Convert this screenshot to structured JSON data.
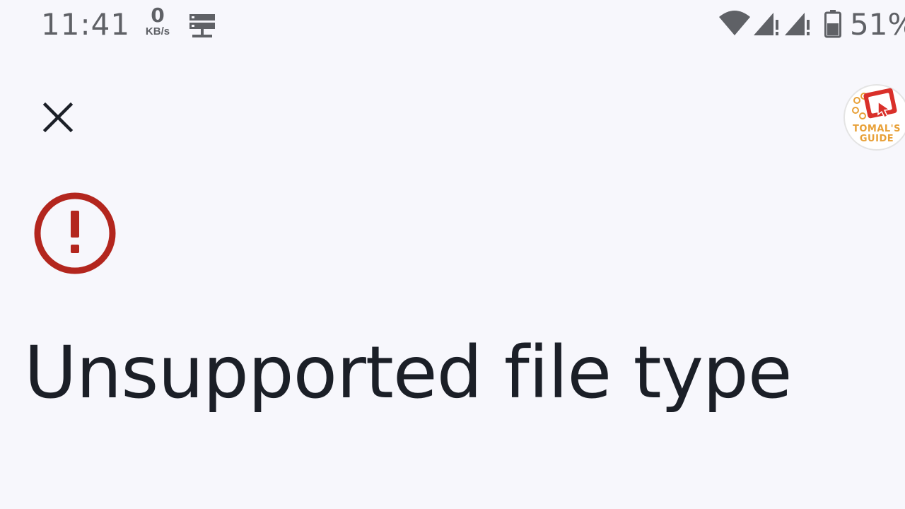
{
  "status_bar": {
    "time": "11:41",
    "net_speed_value": "0",
    "net_speed_unit": "KB/s",
    "battery_percent": "51%",
    "icons": [
      "server-icon",
      "wifi-icon",
      "signal-icon",
      "signal-icon",
      "battery-icon"
    ]
  },
  "dialog": {
    "close_icon": "close-icon",
    "error_icon": "error-icon",
    "error_color": "#b3261e",
    "title": "Unsupported file type"
  },
  "watermark": {
    "line1": "TOMAL'S",
    "line2": "GUIDE"
  }
}
